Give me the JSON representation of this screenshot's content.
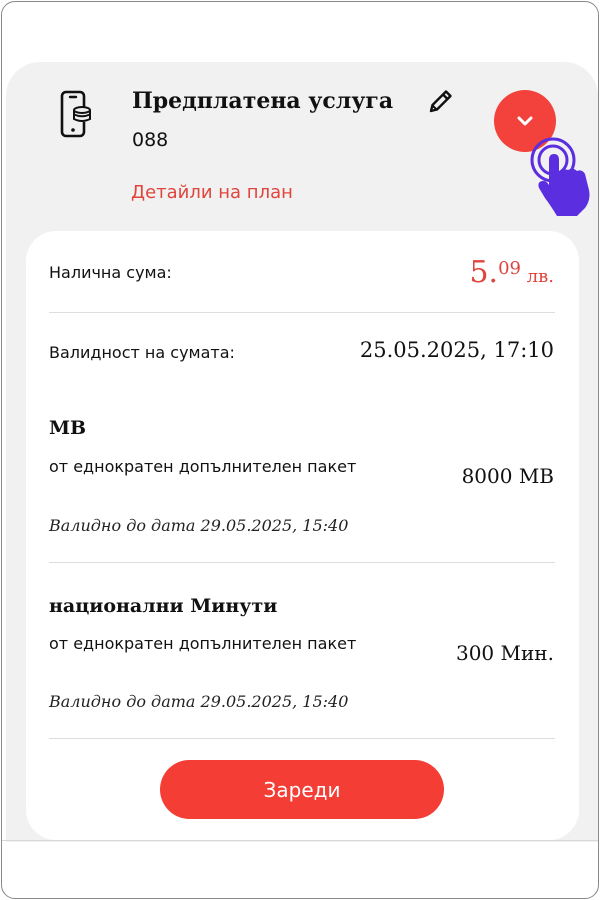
{
  "plan": {
    "title": "Предплатена услуга",
    "number": "088",
    "details_link": "Детайли на план"
  },
  "balance": {
    "label": "Налична сума:",
    "integer": "5.",
    "decimals": "09",
    "currency": " лв."
  },
  "validity": {
    "label": "Валидност на сумата:",
    "value": "25.05.2025, 17:10"
  },
  "packages": [
    {
      "name": "MB",
      "description": "от еднократен допълнителен пакет",
      "valid_until": "Валидно до дата 29.05.2025, 15:40",
      "amount": "8000 MB"
    },
    {
      "name": "национални Минути",
      "description": "от еднократен допълнителен пакет",
      "valid_until": "Валидно до дата 29.05.2025, 15:40",
      "amount": "300 Мин."
    }
  ],
  "actions": {
    "charge": "Зареди"
  },
  "colors": {
    "accent": "#f33d35",
    "link": "#e0453d",
    "hand": "#5b2ee0"
  },
  "icons": {
    "service": "phone-database-icon",
    "edit": "pencil-icon",
    "expand": "chevron-down-icon",
    "pointer": "tap-hand-icon"
  }
}
